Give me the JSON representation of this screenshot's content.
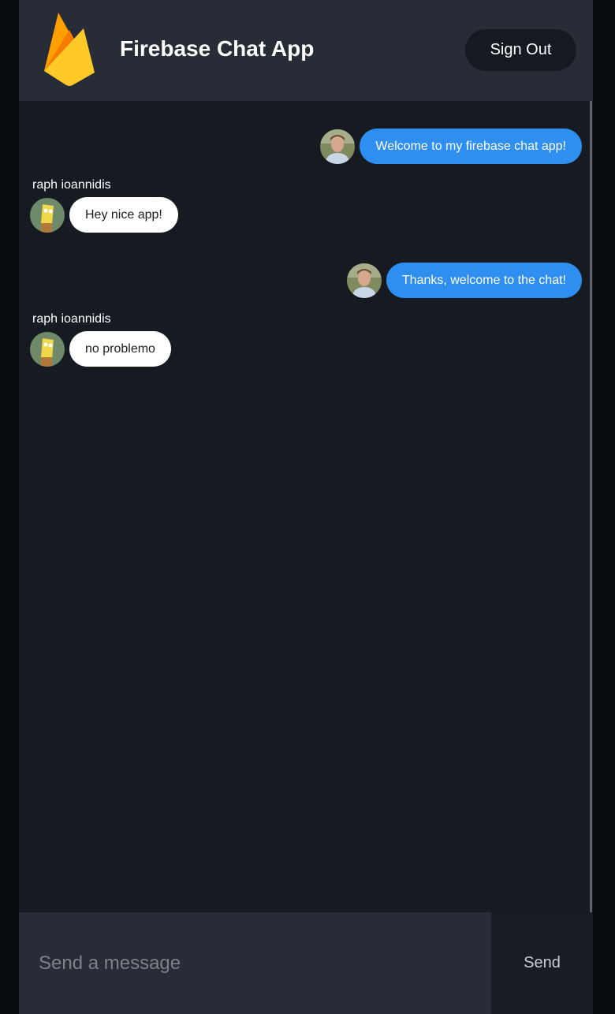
{
  "header": {
    "title": "Firebase Chat App",
    "sign_out_label": "Sign Out",
    "logo_icon": "firebase-flame-icon"
  },
  "messages": [
    {
      "type": "sent",
      "text": "Welcome to my firebase chat app!",
      "avatar": "user-photo"
    },
    {
      "type": "received",
      "sender": "raph ioannidis",
      "text": "Hey nice app!",
      "avatar": "spongebob-avatar"
    },
    {
      "type": "sent",
      "text": "Thanks, welcome to the chat!",
      "avatar": "user-photo"
    },
    {
      "type": "received",
      "sender": "raph ioannidis",
      "text": "no problemo",
      "avatar": "spongebob-avatar"
    }
  ],
  "composer": {
    "placeholder": "Send a message",
    "value": "",
    "send_label": "Send"
  },
  "colors": {
    "sent_bubble": "#2f8ff0",
    "received_bubble": "#ffffff",
    "header_bg": "#272c36",
    "chat_bg": "#161a21"
  }
}
